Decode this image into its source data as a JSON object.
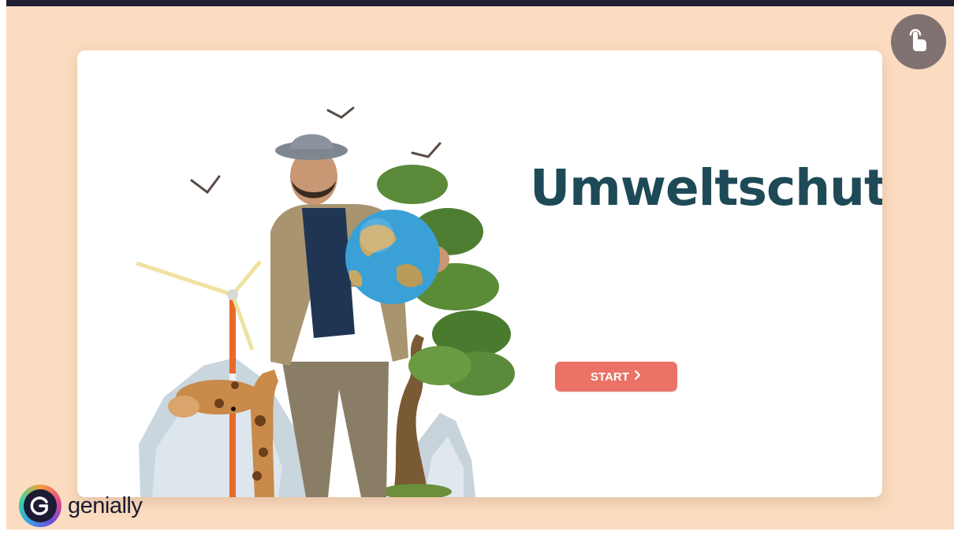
{
  "title": "Umweltschutz",
  "start_button": {
    "label": "START",
    "icon": "chevron-right-icon"
  },
  "touch_button": {
    "icon": "touch-hand-icon"
  },
  "brand": {
    "name": "genially",
    "logo_icon": "genially-logo-icon"
  },
  "colors": {
    "stage_bg": "#fcdcc0",
    "title": "#1e4a57",
    "button": "#ea7266",
    "fab": "#807271",
    "top_bar": "#1e1f33"
  },
  "illustration": {
    "description_icons": [
      "man-with-globe",
      "tree",
      "wind-turbine",
      "giraffe",
      "birds",
      "iceberg"
    ]
  }
}
